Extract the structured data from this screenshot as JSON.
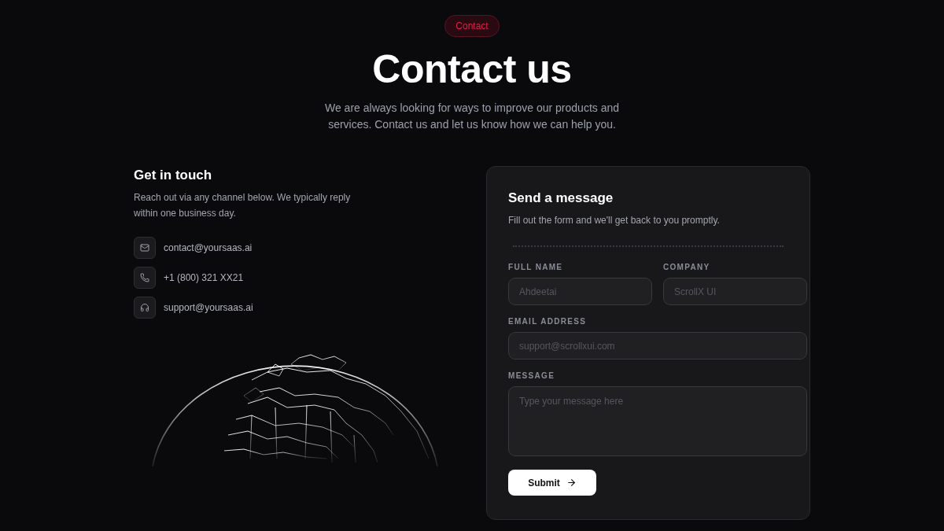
{
  "badge": "Contact",
  "title": "Contact us",
  "subtitle": "We are always looking for ways to improve our products and services. Contact us and let us know how we can help you.",
  "touch": {
    "heading": "Get in touch",
    "text": "Reach out via any channel below. We typically reply within one business day.",
    "channels": [
      {
        "kind": "email",
        "text": "contact@yoursaas.ai"
      },
      {
        "kind": "phone",
        "text": "+1 (800) 321 XX21"
      },
      {
        "kind": "support",
        "text": "support@yoursaas.ai"
      }
    ]
  },
  "form": {
    "heading": "Send a message",
    "text": "Fill out the form and we'll get back to you promptly.",
    "fields": [
      {
        "kind": "input",
        "label": "FULL NAME",
        "placeholder": "Ahdeetai"
      },
      {
        "kind": "input",
        "label": "COMPANY",
        "placeholder": "ScrollX UI"
      },
      {
        "kind": "input",
        "label": "EMAIL ADDRESS",
        "placeholder": "support@scrollxui.com"
      },
      {
        "kind": "textarea",
        "label": "MESSAGE",
        "placeholder": "Type your message here"
      }
    ],
    "submit": "Submit"
  }
}
